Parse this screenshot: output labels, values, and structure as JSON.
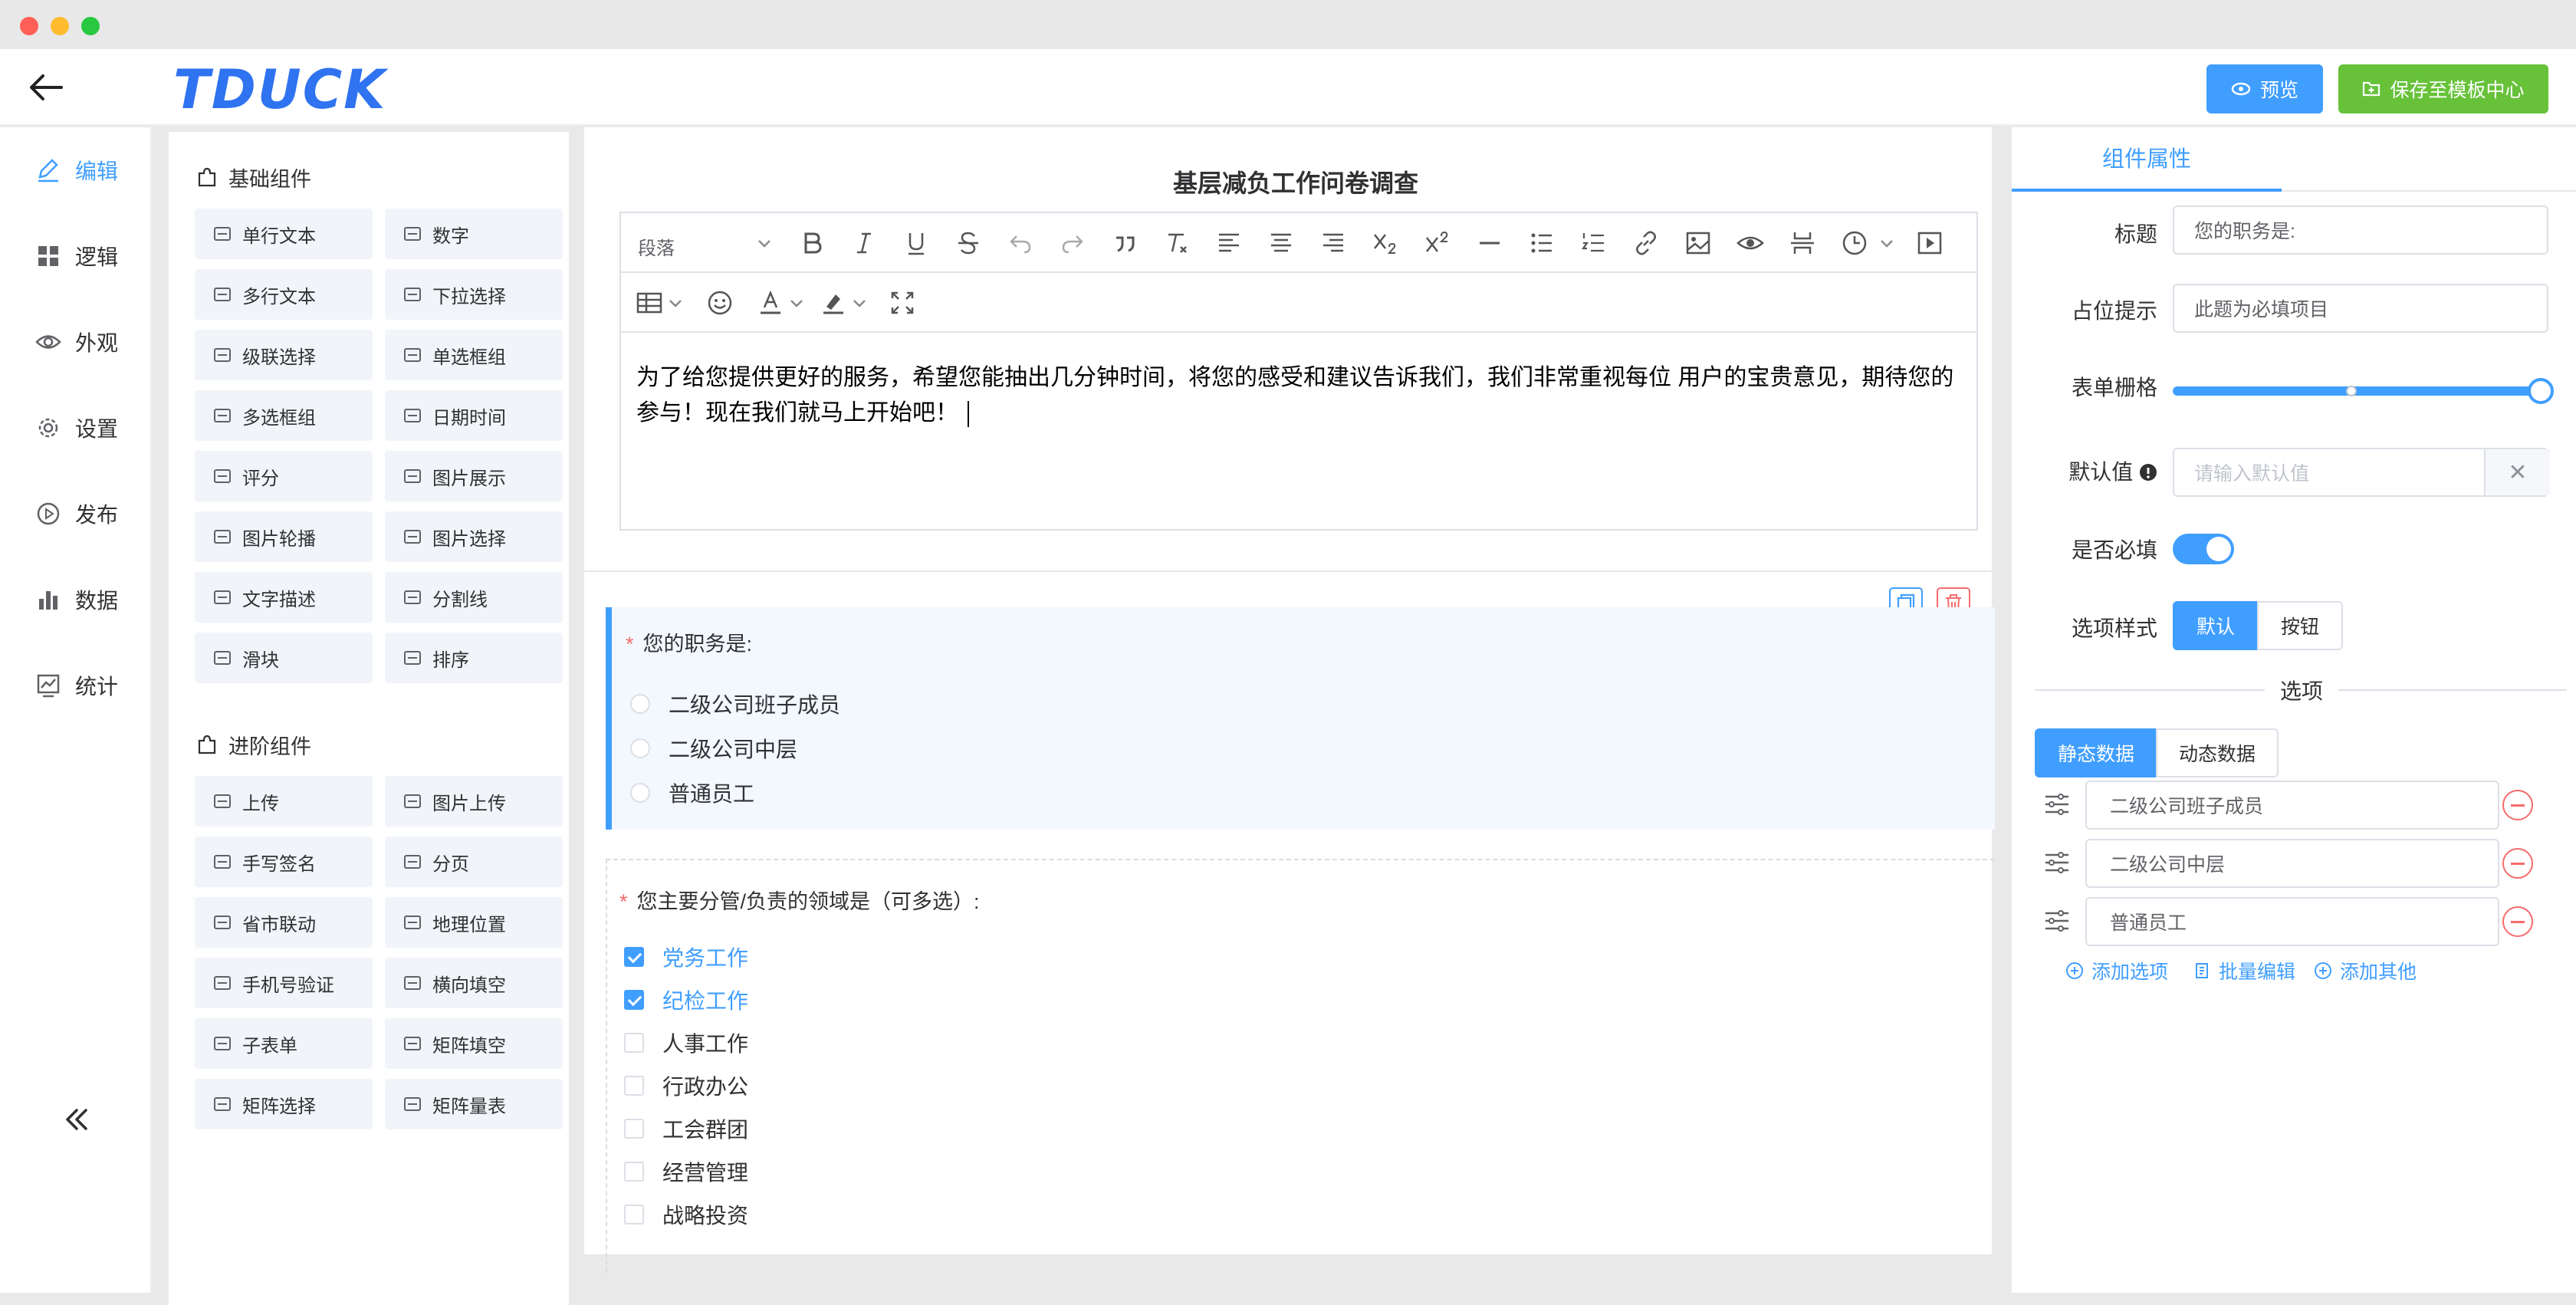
{
  "header": {
    "logo_text": "TDUCK",
    "preview_label": "预览",
    "save_template_label": "保存至模板中心"
  },
  "nav": {
    "items": [
      {
        "label": "编辑",
        "icon": "edit-icon",
        "active": true
      },
      {
        "label": "逻辑",
        "icon": "grid-icon"
      },
      {
        "label": "外观",
        "icon": "eye-icon"
      },
      {
        "label": "设置",
        "icon": "gear-icon"
      },
      {
        "label": "发布",
        "icon": "play-circle-icon"
      },
      {
        "label": "数据",
        "icon": "bar-chart-icon"
      },
      {
        "label": "统计",
        "icon": "line-chart-icon"
      }
    ],
    "collapse_icon": "double-chevron-left-icon"
  },
  "components": {
    "basic_title": "基础组件",
    "basic": [
      {
        "label": "单行文本",
        "icon": "input-icon"
      },
      {
        "label": "数字",
        "icon": "number-icon"
      },
      {
        "label": "多行文本",
        "icon": "textarea-icon"
      },
      {
        "label": "下拉选择",
        "icon": "select-icon"
      },
      {
        "label": "级联选择",
        "icon": "cascader-icon"
      },
      {
        "label": "单选框组",
        "icon": "radio-icon"
      },
      {
        "label": "多选框组",
        "icon": "checkbox-icon"
      },
      {
        "label": "日期时间",
        "icon": "calendar-icon"
      },
      {
        "label": "评分",
        "icon": "star-icon"
      },
      {
        "label": "图片展示",
        "icon": "image-icon"
      },
      {
        "label": "图片轮播",
        "icon": "carousel-icon"
      },
      {
        "label": "图片选择",
        "icon": "image-select-icon"
      },
      {
        "label": "文字描述",
        "icon": "text-icon"
      },
      {
        "label": "分割线",
        "icon": "divider-icon"
      },
      {
        "label": "滑块",
        "icon": "slider-icon"
      },
      {
        "label": "排序",
        "icon": "sort-icon"
      }
    ],
    "advanced_title": "进阶组件",
    "advanced": [
      {
        "label": "上传",
        "icon": "upload-icon"
      },
      {
        "label": "图片上传",
        "icon": "image-upload-icon"
      },
      {
        "label": "手写签名",
        "icon": "signature-icon"
      },
      {
        "label": "分页",
        "icon": "pagination-icon"
      },
      {
        "label": "省市联动",
        "icon": "city-icon"
      },
      {
        "label": "地理位置",
        "icon": "location-icon"
      },
      {
        "label": "手机号验证",
        "icon": "phone-icon"
      },
      {
        "label": "横向填空",
        "icon": "fill-blank-icon"
      },
      {
        "label": "子表单",
        "icon": "sub-form-icon"
      },
      {
        "label": "矩阵填空",
        "icon": "matrix-fill-icon"
      },
      {
        "label": "矩阵选择",
        "icon": "matrix-select-icon"
      },
      {
        "label": "矩阵量表",
        "icon": "matrix-scale-icon"
      }
    ]
  },
  "editor": {
    "form_title": "基层减负工作问卷调查",
    "paragraph_select": "段落",
    "content": "为了给您提供更好的服务，希望您能抽出几分钟时间，将您的感受和建议告诉我们，我们非常重视每位 用户的宝贵意见，期待您的参与！现在我们就马上开始吧！"
  },
  "question1": {
    "required_mark": "*",
    "title": "您的职务是:",
    "options": [
      "二级公司班子成员",
      "二级公司中层",
      "普通员工"
    ]
  },
  "question2": {
    "required_mark": "*",
    "title": "您主要分管/负责的领域是（可多选）:",
    "options": [
      {
        "label": "党务工作",
        "checked": true
      },
      {
        "label": "纪检工作",
        "checked": true
      },
      {
        "label": "人事工作",
        "checked": false
      },
      {
        "label": "行政办公",
        "checked": false
      },
      {
        "label": "工会群团",
        "checked": false
      },
      {
        "label": "经营管理",
        "checked": false
      },
      {
        "label": "战略投资",
        "checked": false
      }
    ]
  },
  "props": {
    "tab_label": "组件属性",
    "title_label": "标题",
    "title_value": "您的职务是:",
    "placeholder_label": "占位提示",
    "placeholder_value": "此题为必填项目",
    "grid_label": "表单栅格",
    "grid_value": 24,
    "grid_max": 24,
    "default_label": "默认值",
    "default_placeholder": "请输入默认值",
    "default_clear": "✕",
    "required_label": "是否必填",
    "required_on": true,
    "style_label": "选项样式",
    "style_default": "默认",
    "style_button": "按钮",
    "options_heading": "选项",
    "static_data": "静态数据",
    "dynamic_data": "动态数据",
    "option_values": [
      "二级公司班子成员",
      "二级公司中层",
      "普通员工"
    ],
    "add_option": "添加选项",
    "batch_edit": "批量编辑",
    "add_other": "添加其他",
    "accent_color": "#409eff",
    "success_color": "#67c23a",
    "danger_color": "#f56c6c"
  }
}
